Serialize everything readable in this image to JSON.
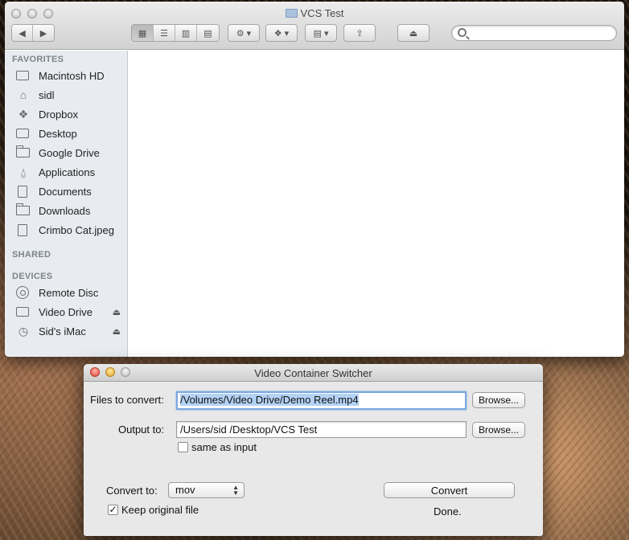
{
  "finder": {
    "title": "VCS Test",
    "sections": {
      "favorites": "FAVORITES",
      "shared": "SHARED",
      "devices": "DEVICES"
    },
    "favorites": [
      {
        "label": "Macintosh HD",
        "icon": "hard-drive-icon"
      },
      {
        "label": "sidl",
        "icon": "home-icon"
      },
      {
        "label": "Dropbox",
        "icon": "dropbox-icon"
      },
      {
        "label": "Desktop",
        "icon": "desktop-icon"
      },
      {
        "label": "Google Drive",
        "icon": "folder-icon"
      },
      {
        "label": "Applications",
        "icon": "applications-icon"
      },
      {
        "label": "Documents",
        "icon": "documents-icon"
      },
      {
        "label": "Downloads",
        "icon": "folder-icon"
      },
      {
        "label": "Crimbo Cat.jpeg",
        "icon": "file-icon"
      }
    ],
    "devices": [
      {
        "label": "Remote Disc",
        "icon": "disc-icon"
      },
      {
        "label": "Video Drive",
        "icon": "drive-icon",
        "eject": "⏏"
      },
      {
        "label": "Sid's iMac",
        "icon": "time-machine-icon",
        "eject": "⏏"
      }
    ]
  },
  "vcs": {
    "title": "Video Container Switcher",
    "files_label": "Files to convert:",
    "files_value": "/Volumes/Video Drive/Demo Reel.mp4",
    "browse_label": "Browse...",
    "output_label": "Output to:",
    "output_value": "/Users/sid          /Desktop/VCS Test",
    "same_as_input": "same as input",
    "convert_to_label": "Convert to:",
    "convert_to_value": "mov",
    "convert_button": "Convert",
    "keep_original": "Keep original file",
    "status": "Done."
  }
}
